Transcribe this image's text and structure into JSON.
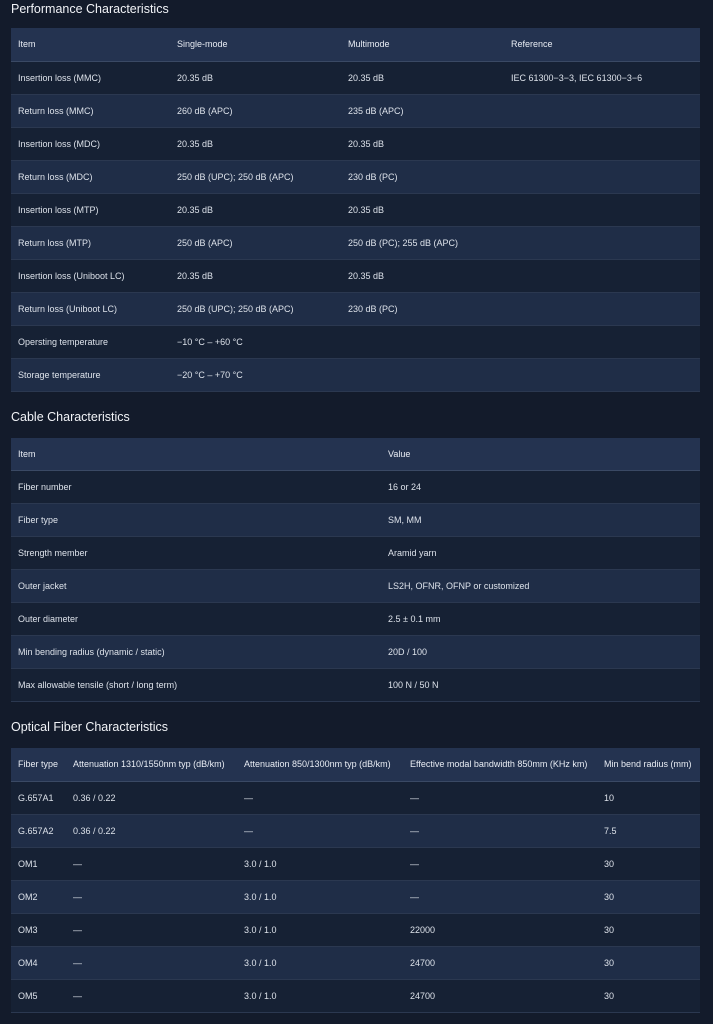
{
  "performance": {
    "title": "Performance Characteristics",
    "headers": [
      "Item",
      "Single-mode",
      "Multimode",
      "Reference"
    ],
    "rows": [
      [
        "Insertion loss (MMC)",
        "20.35 dB",
        "20.35 dB",
        "IEC 61300−3−3, IEC 61300−3−6"
      ],
      [
        "Return loss (MMC)",
        "260 dB (APC)",
        "235 dB (APC)",
        ""
      ],
      [
        "Insertion loss (MDC)",
        "20.35 dB",
        "20.35 dB",
        ""
      ],
      [
        "Return loss (MDC)",
        "250 dB (UPC); 250 dB (APC)",
        "230 dB (PC)",
        ""
      ],
      [
        "Insertion loss (MTP)",
        "20.35 dB",
        "20.35 dB",
        ""
      ],
      [
        "Return loss (MTP)",
        "250 dB (APC)",
        "250 dB (PC); 255 dB (APC)",
        ""
      ],
      [
        "Insertion loss (Uniboot LC)",
        "20.35 dB",
        "20.35 dB",
        ""
      ],
      [
        "Return loss (Uniboot LC)",
        "250 dB (UPC); 250 dB (APC)",
        "230 dB (PC)",
        ""
      ],
      [
        "Opersting temperature",
        "−10 °C – +60 °C",
        "",
        ""
      ],
      [
        "Storage temperature",
        "−20 °C – +70 °C",
        "",
        ""
      ]
    ]
  },
  "cable": {
    "title": "Cable Characteristics",
    "headers": [
      "Item",
      "Value"
    ],
    "rows": [
      [
        "Fiber number",
        "16 or 24"
      ],
      [
        "Fiber type",
        "SM, MM"
      ],
      [
        "Strength member",
        "Aramid yarn"
      ],
      [
        "Outer jacket",
        "LS2H, OFNR, OFNP or customized"
      ],
      [
        "Outer diameter",
        "2.5 ± 0.1 mm"
      ],
      [
        "Min bending radius (dynamic / static)",
        "20D / 100"
      ],
      [
        "Max allowable tensile (short / long term)",
        "100 N / 50 N"
      ]
    ]
  },
  "optical": {
    "title": "Optical Fiber Characteristics",
    "headers": [
      "Fiber type",
      "Attenuation 1310/1550nm typ (dB/km)",
      "Attenuation 850/1300nm typ (dB/km)",
      "Effective modal bandwidth 850mm (KHz km)",
      "Min bend radius (mm)"
    ],
    "rows": [
      [
        "G.657A1",
        "0.36 / 0.22",
        "—",
        "—",
        "10"
      ],
      [
        "G.657A2",
        "0.36 / 0.22",
        "—",
        "—",
        "7.5"
      ],
      [
        "OM1",
        "—",
        "3.0 / 1.0",
        "—",
        "30"
      ],
      [
        "OM2",
        "—",
        "3.0 / 1.0",
        "—",
        "30"
      ],
      [
        "OM3",
        "—",
        "3.0 / 1.0",
        "22000",
        "30"
      ],
      [
        "OM4",
        "—",
        "3.0 / 1.0",
        "24700",
        "30"
      ],
      [
        "OM5",
        "—",
        "3.0 / 1.0",
        "24700",
        "30"
      ]
    ]
  }
}
